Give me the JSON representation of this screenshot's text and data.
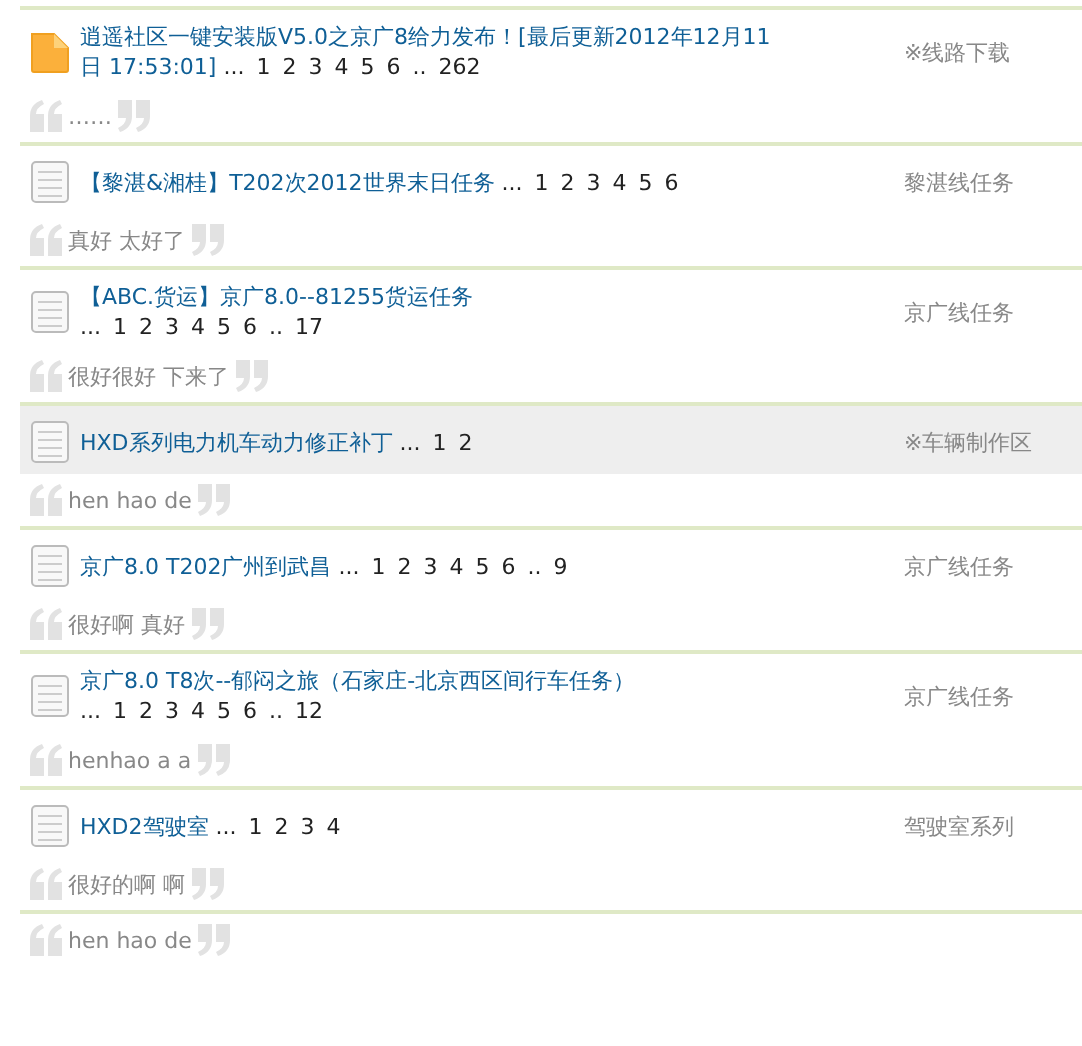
{
  "threads": [
    {
      "kind": "folder",
      "highlighted": false,
      "title_lines": [
        "逍遥社区一键安装版V5.0之京广8给力发布！[最后更新2012年12月11",
        "日 17:53:01]"
      ],
      "pager_break": false,
      "pager": {
        "lead": "...",
        "pages": [
          "1",
          "2",
          "3",
          "4",
          "5",
          "6"
        ],
        "gap": "..",
        "last": "262"
      },
      "forum": "※线路下载",
      "excerpt": "……"
    },
    {
      "kind": "doc",
      "highlighted": false,
      "title": "【黎湛&湘桂】T202次2012世界末日任务",
      "pager_break": false,
      "pager": {
        "lead": "...",
        "pages": [
          "1",
          "2",
          "3",
          "4",
          "5",
          "6"
        ]
      },
      "forum": "黎湛线任务",
      "excerpt": "真好 太好了"
    },
    {
      "kind": "doc",
      "highlighted": false,
      "title": "【ABC.货运】京广8.0--81255货运任务",
      "pager_break": true,
      "pager": {
        "lead": "...",
        "pages": [
          "1",
          "2",
          "3",
          "4",
          "5",
          "6"
        ],
        "gap": "..",
        "last": "17"
      },
      "forum": "京广线任务",
      "excerpt": "很好很好 下来了"
    },
    {
      "kind": "doc",
      "highlighted": true,
      "title": "HXD系列电力机车动力修正补丁",
      "pager_break": false,
      "pager": {
        "lead": "...",
        "pages": [
          "1",
          "2"
        ]
      },
      "forum": "※车辆制作区",
      "excerpt": "hen hao de"
    },
    {
      "kind": "doc",
      "highlighted": false,
      "title": "京广8.0 T202广州到武昌",
      "pager_break": false,
      "pager": {
        "lead": "...",
        "pages": [
          "1",
          "2",
          "3",
          "4",
          "5",
          "6"
        ],
        "gap": "..",
        "last": "9"
      },
      "forum": "京广线任务",
      "excerpt": "很好啊 真好"
    },
    {
      "kind": "doc",
      "highlighted": false,
      "title": "京广8.0 T8次--郁闷之旅（石家庄-北京西区间行车任务）",
      "pager_break": true,
      "pager": {
        "lead": "...",
        "pages": [
          "1",
          "2",
          "3",
          "4",
          "5",
          "6"
        ],
        "gap": "..",
        "last": "12"
      },
      "forum": "京广线任务",
      "excerpt": "henhao a a"
    },
    {
      "kind": "doc",
      "highlighted": false,
      "title": "HXD2驾驶室",
      "pager_break": false,
      "pager": {
        "lead": "...",
        "pages": [
          "1",
          "2",
          "3",
          "4"
        ]
      },
      "forum": "驾驶室系列",
      "excerpt": "很好的啊 啊"
    },
    {
      "kind": "excerpt_only",
      "excerpt": "hen hao de"
    }
  ]
}
